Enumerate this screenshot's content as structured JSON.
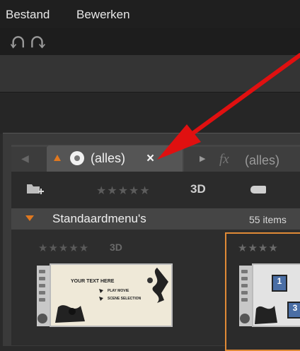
{
  "menu": {
    "bestand": "Bestand",
    "bewerken": "Bewerken"
  },
  "tabs": {
    "left_arrow": "◀",
    "active_label": "(alles)",
    "close": "×",
    "fx_arrow": "▶",
    "fx_symbol": "fx",
    "fx_label": "(alles)"
  },
  "filter": {
    "stars": "★★★★★",
    "label_3d": "3D"
  },
  "group": {
    "title": "Standaardmenu's",
    "count": "55 items"
  },
  "items": [
    {
      "stars": "★★★★★",
      "label_3d": "3D",
      "thumb_text": "YOUR TEXT HERE",
      "thumb_line1": "PLAY MOVIE",
      "thumb_line2": "SCENE SELECTION"
    },
    {
      "stars": "★★★★",
      "thumb_page": "1",
      "thumb_page2": "3"
    }
  ],
  "icons": {
    "undo": "undo-icon",
    "redo": "redo-icon",
    "disc": "disc-icon",
    "folder": "folder-add-icon",
    "tag": "tag-icon"
  },
  "colors": {
    "accent_orange": "#e0781f",
    "arrow_red": "#e01010"
  }
}
